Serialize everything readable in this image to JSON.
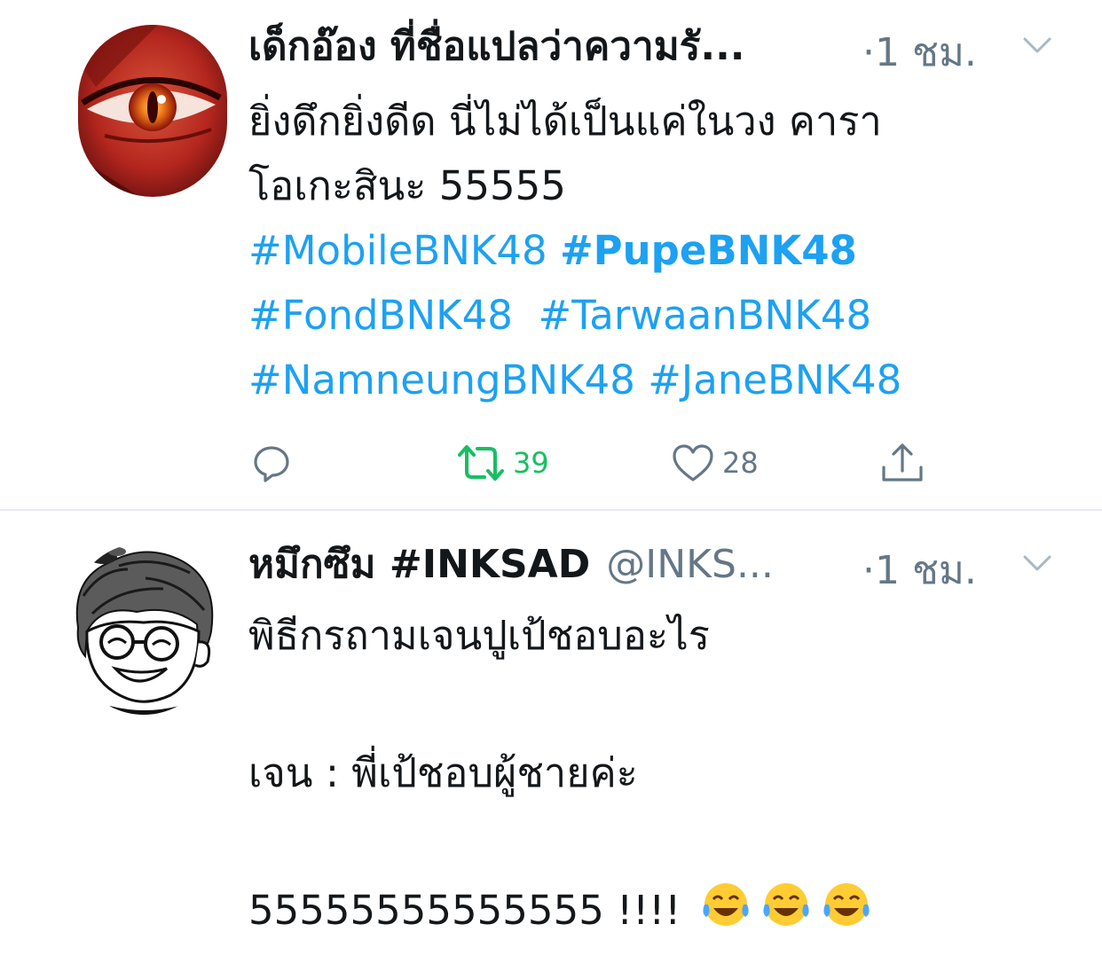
{
  "tweets": [
    {
      "name": "เด็กอ๊อง ที่ชื่อแปลว่าความรั...",
      "handle": "",
      "time": "·1 ชม.",
      "lines": [
        "ยิ่งดึกยิ่งดีด นี่ไม่ได้เป็นแค่ในวง คารา",
        "โอเกะสินะ 55555"
      ],
      "hashtags": [
        [
          "#MobileBNK48",
          "#PupeBNK48"
        ],
        [
          "#FondBNK48",
          "#TarwaanBNK48"
        ],
        [
          "#NamneungBNK48",
          "#JaneBNK48"
        ]
      ],
      "actions": {
        "retweets": "39",
        "likes": "28"
      }
    },
    {
      "name": "หมึกซึม #INKSAD",
      "handle": "@INKS...",
      "time": "·1 ชม.",
      "lines": [
        "พิธีกรถามเจนปูเป้ชอบอะไร",
        "เจน : พี่เป้ชอบผู้ชายค่ะ",
        "55555555555555 !!!!"
      ]
    }
  ],
  "colors": {
    "link": "#1da1f2",
    "retweet_active": "#17bf63",
    "meta": "#657786",
    "text": "#14171a"
  },
  "icons": [
    "reply-icon",
    "retweet-icon",
    "like-icon",
    "share-icon",
    "chevron-down-icon",
    "laughing-emoji"
  ]
}
